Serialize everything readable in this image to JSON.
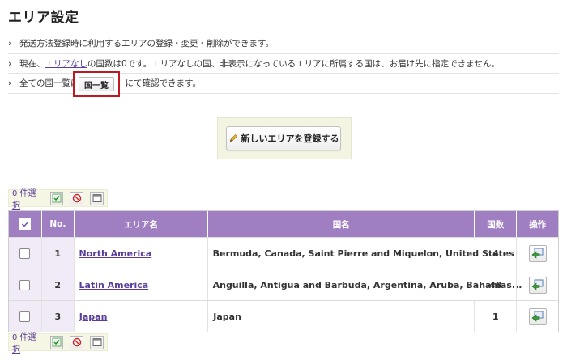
{
  "page": {
    "title": "エリア設定"
  },
  "notes": {
    "line1": "発送方法登録時に利用するエリアの登録・変更・削除ができます。",
    "line2_prefix": "現在、",
    "line2_link": "エリアなし",
    "line2_suffix": "の国数は0です。エリアなしの国、非表示になっているエリアに所属する国は、お届け先に指定できません。",
    "line3_prefix": "全ての国一覧は",
    "line3_suffix": "にて確認できます。"
  },
  "buttons": {
    "country_list": "国一覧",
    "register_area": "新しいエリアを登録する"
  },
  "toolbar": {
    "selected_count": "0 件選択"
  },
  "table": {
    "headers": {
      "no": "No.",
      "area_name": "エリア名",
      "countries": "国名",
      "count": "国数",
      "operation": "操作"
    },
    "rows": [
      {
        "no": "1",
        "area_name": "North America",
        "countries": "Bermuda, Canada, Saint Pierre and Miquelon, United States",
        "count": "4"
      },
      {
        "no": "2",
        "area_name": "Latin America",
        "countries": "Anguilla, Antigua and Barbuda, Argentina, Aruba, Bahamas...",
        "count": "48"
      },
      {
        "no": "3",
        "area_name": "Japan",
        "countries": "Japan",
        "count": "1"
      }
    ]
  },
  "colors": {
    "header_purple": "#a07ec2",
    "link_purple": "#5a3d9a",
    "highlight_red": "#c01820",
    "panel_bg": "#f4f4e2"
  },
  "icons": [
    "chevron-right-icon",
    "pencil-icon",
    "check-all-icon",
    "uncheck-all-icon",
    "window-icon",
    "edit-arrow-icon"
  ]
}
